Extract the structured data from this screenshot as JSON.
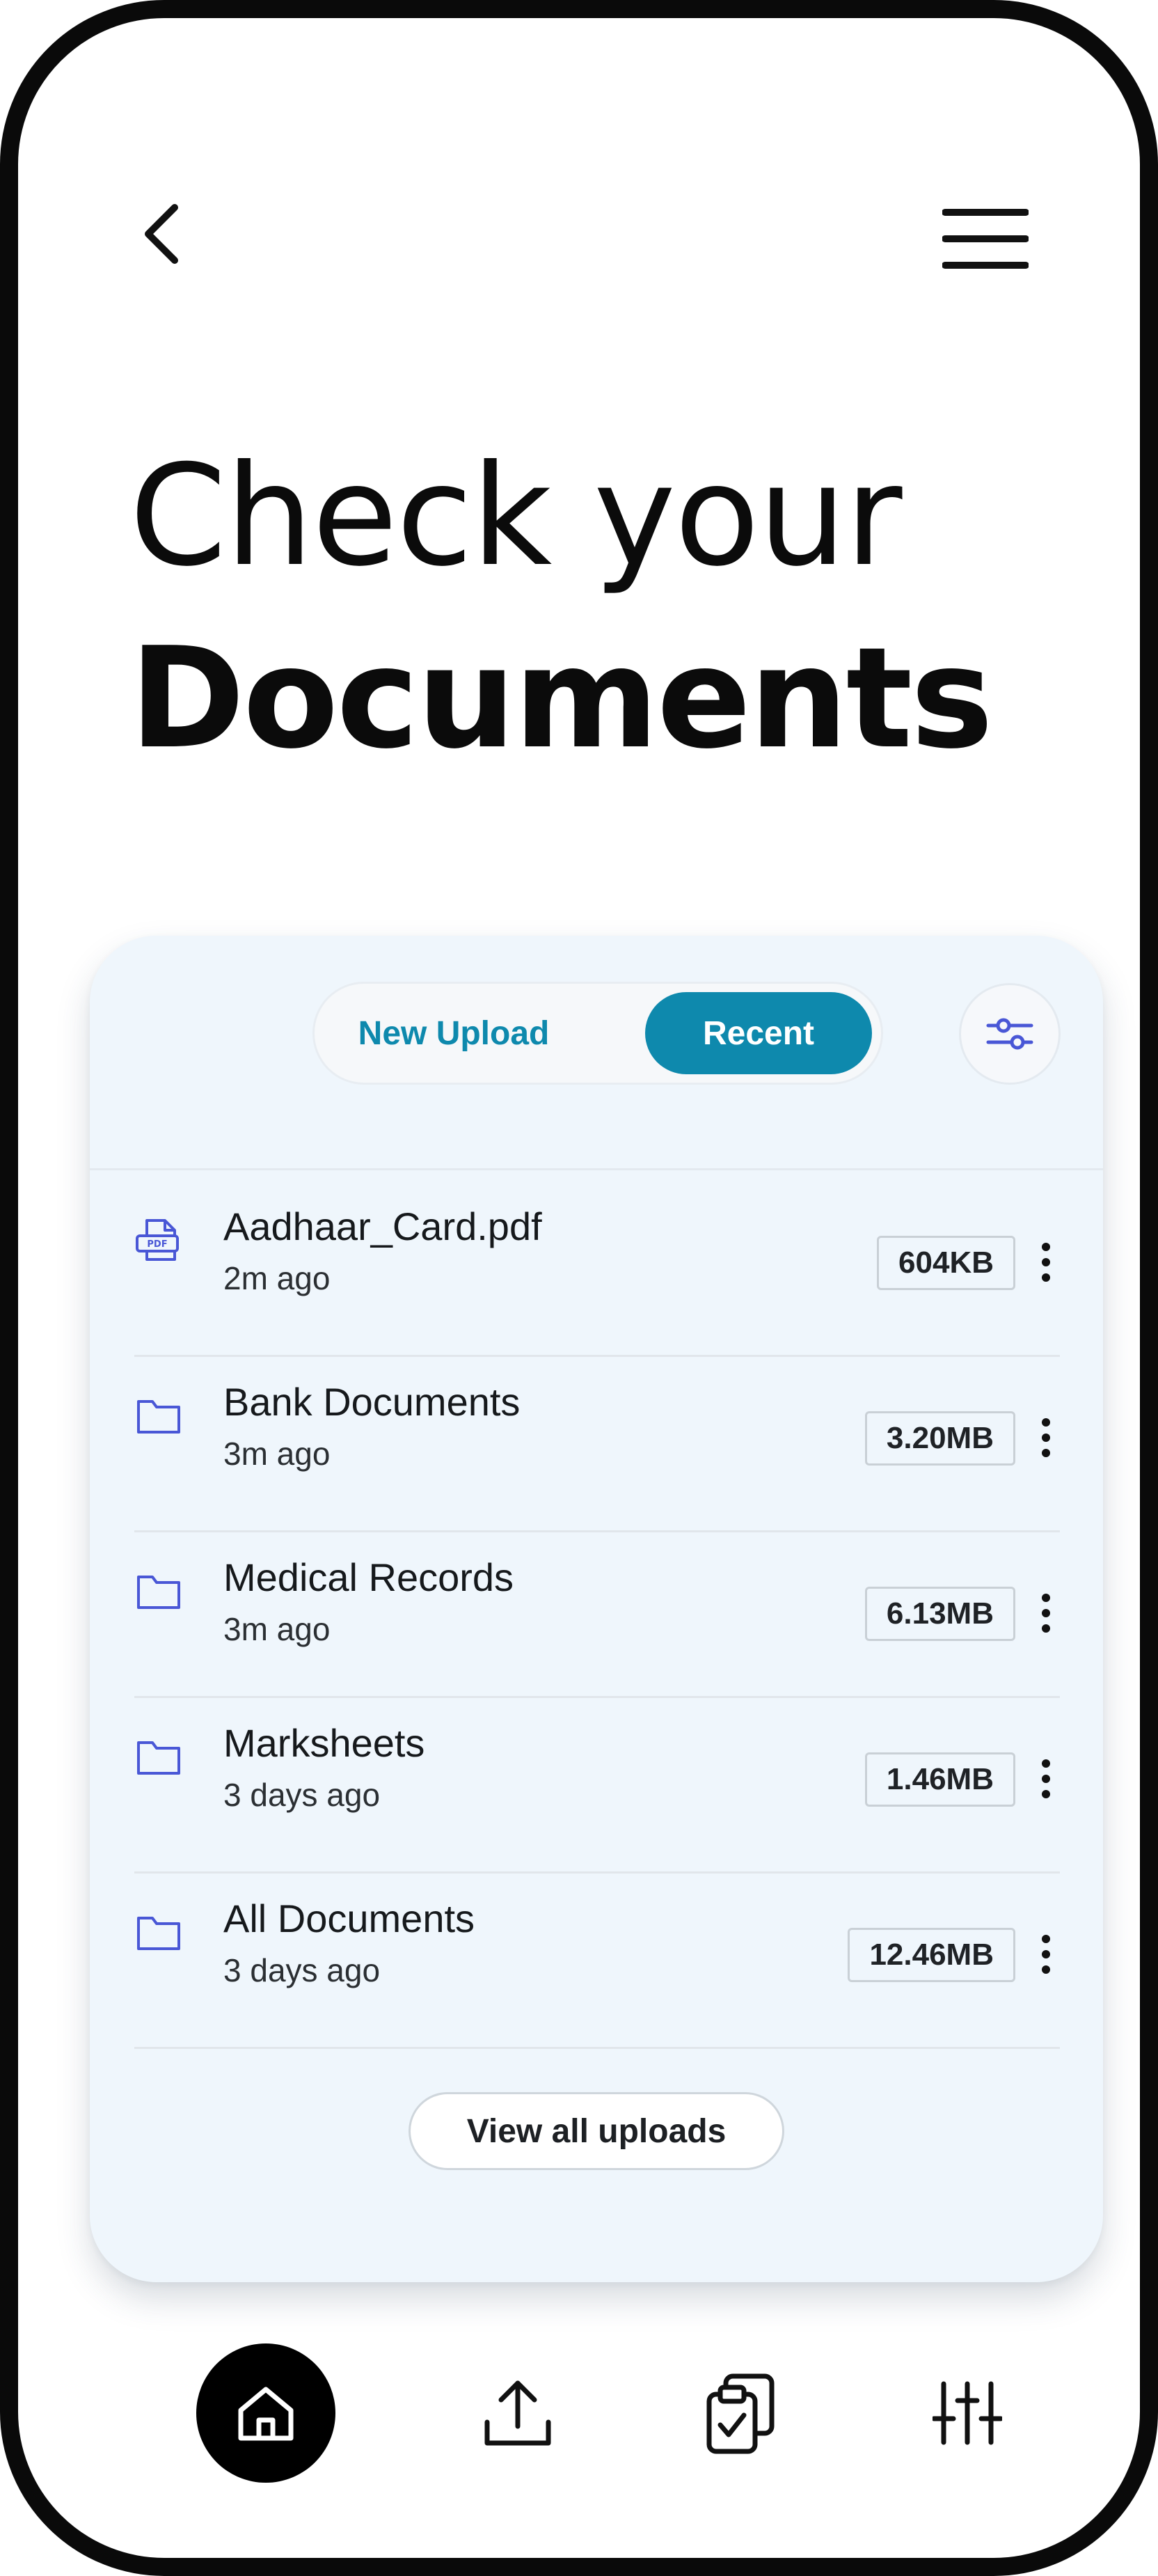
{
  "header": {
    "back_icon": "chevron-left-icon",
    "menu_icon": "hamburger-menu-icon"
  },
  "title": {
    "line1": "Check your",
    "line2": "Documents"
  },
  "tabs": {
    "new_upload": "New Upload",
    "recent": "Recent",
    "active": "Recent"
  },
  "filter_icon": "sliders-filter-icon",
  "files": [
    {
      "name": "Aadhaar_Card.pdf",
      "time": "2m ago",
      "size": "604KB",
      "icon": "pdf-file-icon"
    },
    {
      "name": "Bank Documents",
      "time": "3m ago",
      "size": "3.20MB",
      "icon": "folder-icon"
    },
    {
      "name": "Medical Records",
      "time": "3m ago",
      "size": "6.13MB",
      "icon": "folder-icon"
    },
    {
      "name": "Marksheets",
      "time": "3 days ago",
      "size": "1.46MB",
      "icon": "folder-icon"
    },
    {
      "name": "All Documents",
      "time": "3 days ago",
      "size": "12.46MB",
      "icon": "folder-icon"
    }
  ],
  "view_all_label": "View all uploads",
  "nav": {
    "items": [
      "home-icon",
      "upload-icon",
      "clipboard-check-icon",
      "settings-sliders-icon"
    ],
    "active": "home-icon"
  },
  "colors": {
    "accent": "#0e89ad",
    "icon_blue": "#4957d6",
    "card_bg": "#eff6fc",
    "frame": "#0a0a0a"
  }
}
